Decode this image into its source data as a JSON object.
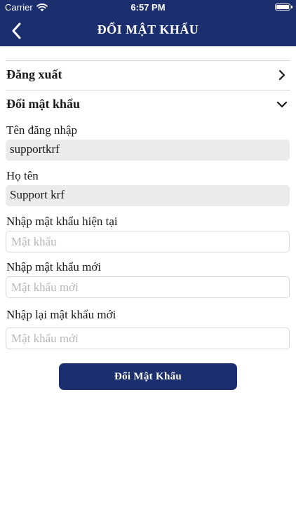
{
  "status_bar": {
    "carrier": "Carrier",
    "time": "6:57 PM"
  },
  "nav": {
    "title": "ĐỔI MẬT KHẨU",
    "back_icon": "chevron-left-icon"
  },
  "menu": {
    "logout_label": "Đăng xuất",
    "change_password_label": "Đổi mật khẩu"
  },
  "form": {
    "username_label": "Tên đăng nhập",
    "username_value": "supportkrf",
    "fullname_label": "Họ tên",
    "fullname_value": "Support krf",
    "current_password_label": "Nhập mật khẩu hiện tại",
    "current_password_placeholder": "Mật khẩu",
    "new_password_label": "Nhập mật khẩu mới",
    "new_password_placeholder": "Mật khẩu mới",
    "confirm_password_label": "Nhập lại mật khẩu mới",
    "confirm_password_placeholder": "Mật khẩu mới",
    "submit_label": "Đổi Mật Khẩu"
  },
  "colors": {
    "primary": "#1b2e6d",
    "readonly_bg": "#ebebeb",
    "placeholder": "#b7b7b7"
  }
}
